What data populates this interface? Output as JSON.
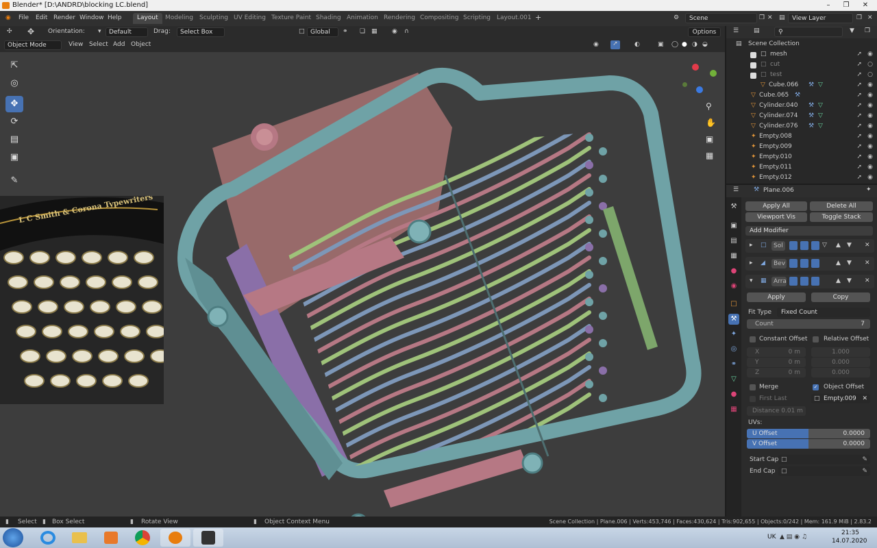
{
  "window": {
    "title": "Blender* [D:\\ANDRD\\blocking LC.blend]"
  },
  "menus": [
    "File",
    "Edit",
    "Render",
    "Window",
    "Help"
  ],
  "workspaces": [
    "Layout",
    "Modeling",
    "Sculpting",
    "UV Editing",
    "Texture Paint",
    "Shading",
    "Animation",
    "Rendering",
    "Compositing",
    "Scripting",
    "Layout.001"
  ],
  "scene": {
    "name": "Scene",
    "view_layer": "View Layer"
  },
  "header1": {
    "orientation_label": "Orientation:",
    "orientation_value": "Default",
    "drag_label": "Drag:",
    "drag_value": "Select Box",
    "transform_value": "Global",
    "options": "Options"
  },
  "header2": {
    "mode": "Object Mode",
    "view": "View",
    "select": "Select",
    "add": "Add",
    "object": "Object"
  },
  "outliner": {
    "root": "Scene Collection",
    "rows": [
      {
        "name": "mesh"
      },
      {
        "name": "cut"
      },
      {
        "name": "test"
      },
      {
        "name": "Cube.066"
      },
      {
        "name": "Cube.065"
      },
      {
        "name": "Cylinder.040"
      },
      {
        "name": "Cylinder.074"
      },
      {
        "name": "Cylinder.076"
      },
      {
        "name": "Empty.008"
      },
      {
        "name": "Empty.009"
      },
      {
        "name": "Empty.010"
      },
      {
        "name": "Empty.011"
      },
      {
        "name": "Empty.012"
      }
    ]
  },
  "properties": {
    "object_name": "Plane.006",
    "apply_all": "Apply All",
    "delete_all": "Delete All",
    "viewport_vis": "Viewport Vis",
    "toggle_stack": "Toggle Stack",
    "add_modifier": "Add Modifier",
    "modifiers": [
      {
        "name": "Sol"
      },
      {
        "name": "Bev"
      },
      {
        "name": "Arra"
      }
    ],
    "apply": "Apply",
    "copy": "Copy",
    "fit_type_label": "Fit Type",
    "fit_type_value": "Fixed Count",
    "count_label": "Count",
    "count_value": "7",
    "constant_offset": "Constant Offset",
    "relative_offset": "Relative Offset",
    "x_label": "X",
    "y_label": "Y",
    "z_label": "Z",
    "const_x": "0 m",
    "const_y": "0 m",
    "const_z": "0 m",
    "rel_x": "1.000",
    "rel_y": "0.000",
    "rel_z": "0.000",
    "merge": "Merge",
    "object_offset": "Object Offset",
    "first_last": "First Last",
    "offset_object": "Empty.009",
    "distance_label": "Distance",
    "distance_value": "0.01 m",
    "uvs": "UVs:",
    "u_offset_label": "U Offset",
    "u_offset_value": "0.0000",
    "v_offset_label": "V Offset",
    "v_offset_value": "0.0000",
    "start_cap": "Start Cap",
    "end_cap": "End Cap"
  },
  "refimage": {
    "brand_text": "L C Smith & Corona Typewriters"
  },
  "statusbar": {
    "select": "Select",
    "box_select": "Box Select",
    "rotate_view": "Rotate View",
    "context_menu": "Object Context Menu",
    "stats": "Scene Collection | Plane.006 | Verts:453,746 | Faces:430,624 | Tris:902,655 | Objects:0/242 | Mem: 161.9 MiB | 2.83.2"
  },
  "taskbar": {
    "lang": "UK",
    "time": "21:35",
    "date": "14.07.2020"
  },
  "colors": {
    "accent": "#4772b3",
    "object_orange": "#e2963a",
    "frame_teal": "#6fa2a6",
    "bar_green": "#9fc27a",
    "bar_blue": "#7d97b8",
    "bar_pink": "#b67884",
    "purple": "#8a6fa8"
  }
}
